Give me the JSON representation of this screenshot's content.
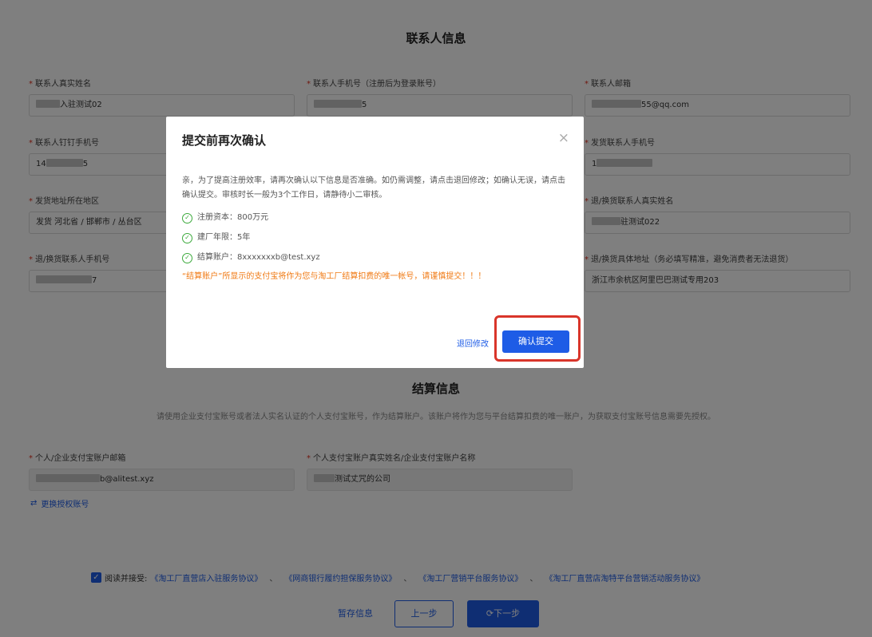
{
  "contact": {
    "title": "联系人信息",
    "fields": {
      "name": {
        "label": "联系人真实姓名",
        "value": "入驻测试02"
      },
      "phone": {
        "label": "联系人手机号（注册后为登录账号）",
        "value": "5"
      },
      "email": {
        "label": "联系人邮箱",
        "value": "55@qq.com"
      },
      "dingtalk": {
        "label": "联系人钉钉手机号",
        "value_start": "14",
        "value_end": "5"
      },
      "ship_phone": {
        "label": "发货联系人手机号",
        "value_start": "1"
      },
      "ship_region": {
        "label": "发货地址所在地区",
        "value": "发货 河北省 / 邯郸市 / 丛台区"
      },
      "return_name": {
        "label": "退/换货联系人真实姓名",
        "value": "驻测试022"
      },
      "return_phone": {
        "label": "退/换货联系人手机号",
        "value": "7"
      },
      "return_address": {
        "label": "退/换货具体地址（务必填写精准，避免消费者无法退货）",
        "value": "浙江市余杭区阿里巴巴测试专用203"
      }
    }
  },
  "settlement": {
    "title": "结算信息",
    "description": "请使用企业支付宝账号或者法人实名认证的个人支付宝账号，作为结算账户。该账户将作为您与平台结算扣费的唯一账户，为获取支付宝账号信息需要先授权。",
    "email": {
      "label": "个人/企业支付宝账户邮箱",
      "value": "b@alitest.xyz"
    },
    "account_name": {
      "label": "个人支付宝账户真实姓名/企业支付宝账户名称",
      "value": "测试丈咒的公司"
    },
    "switch_label": "更换授权账号"
  },
  "agreement": {
    "prefix": "阅读并接受:",
    "links": [
      "《淘工厂直营店入驻服务协议》",
      "《网商银行履约担保服务协议》",
      "《淘工厂营销平台服务协议》",
      "《淘工厂直营店淘特平台营销活动服务协议》"
    ],
    "separator": "、"
  },
  "footer": {
    "save_label": "暂存信息",
    "prev_label": "上一步",
    "next_label": "下一步"
  },
  "modal": {
    "title": "提交前再次确认",
    "close_glyph": "×",
    "intro": "亲，为了提高注册效率，请再次确认以下信息是否准确。如仍需调整，请点击退回修改；如确认无误，请点击确认提交。审核时长一般为3个工作日，请静待小二审核。",
    "items": [
      "注册资本：800万元",
      "建厂年限：5年",
      "结算账户：8xxxxxxxb@test.xyz"
    ],
    "warning": "“结算账户”所显示的支付宝将作为您与淘工厂结算扣费的唯一帐号，请谨慎提交！！！",
    "back_label": "退回修改",
    "confirm_label": "确认提交"
  },
  "colors": {
    "primary": "#1e5ce6",
    "warning": "#f07a14",
    "success": "#3caa3c",
    "highlight": "#d9352a"
  }
}
